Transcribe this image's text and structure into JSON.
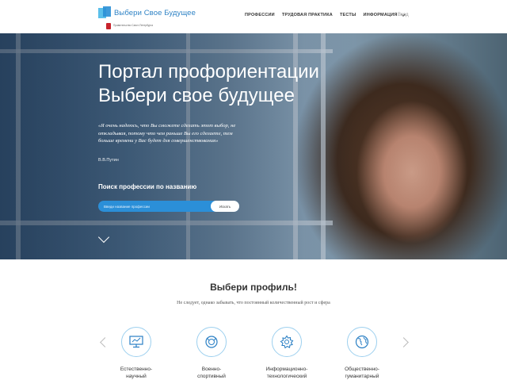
{
  "header": {
    "logo_title": "Выбери Свое Будущее",
    "gov_text": "Правительство Санкт-Петербурга",
    "nav": [
      "ПРОФЕССИИ",
      "ТРУДОВАЯ ПРАКТИКА",
      "ТЕСТЫ",
      "ИНФОРМАЦИЯ"
    ],
    "login": "Вход"
  },
  "hero": {
    "title_line1": "Портал профориентации",
    "title_line2": "Выбери свое будущее",
    "quote": "«Я очень надеюсь, что Вы сможете сделать этот выбор, не откладывая, потому что чем раньше Вы его сделаете, тем больше времени у Вас будет для совершенствования»",
    "quote_author": "В.В.Путин",
    "search_label": "Поиск профессии по названию",
    "search_placeholder": "Введи название профессии",
    "search_button": "Искать"
  },
  "profiles": {
    "title": "Выбери профиль!",
    "subtitle": "Не следует, однако забывать, что постоянный количественный рост и сфера",
    "cards": [
      {
        "label1": "Естественно-",
        "label2": "научный",
        "icon": "monitor-icon"
      },
      {
        "label1": "Военно-",
        "label2": "спортивный",
        "icon": "emblem-icon"
      },
      {
        "label1": "Информационно-",
        "label2": "технологический",
        "icon": "gear-icon"
      },
      {
        "label1": "Общественно-",
        "label2": "гуманитарный",
        "icon": "globe-icon"
      }
    ]
  },
  "colors": {
    "accent": "#2b8fd8",
    "brand": "#2f83c5",
    "icon_stroke": "#2a7fc4"
  }
}
